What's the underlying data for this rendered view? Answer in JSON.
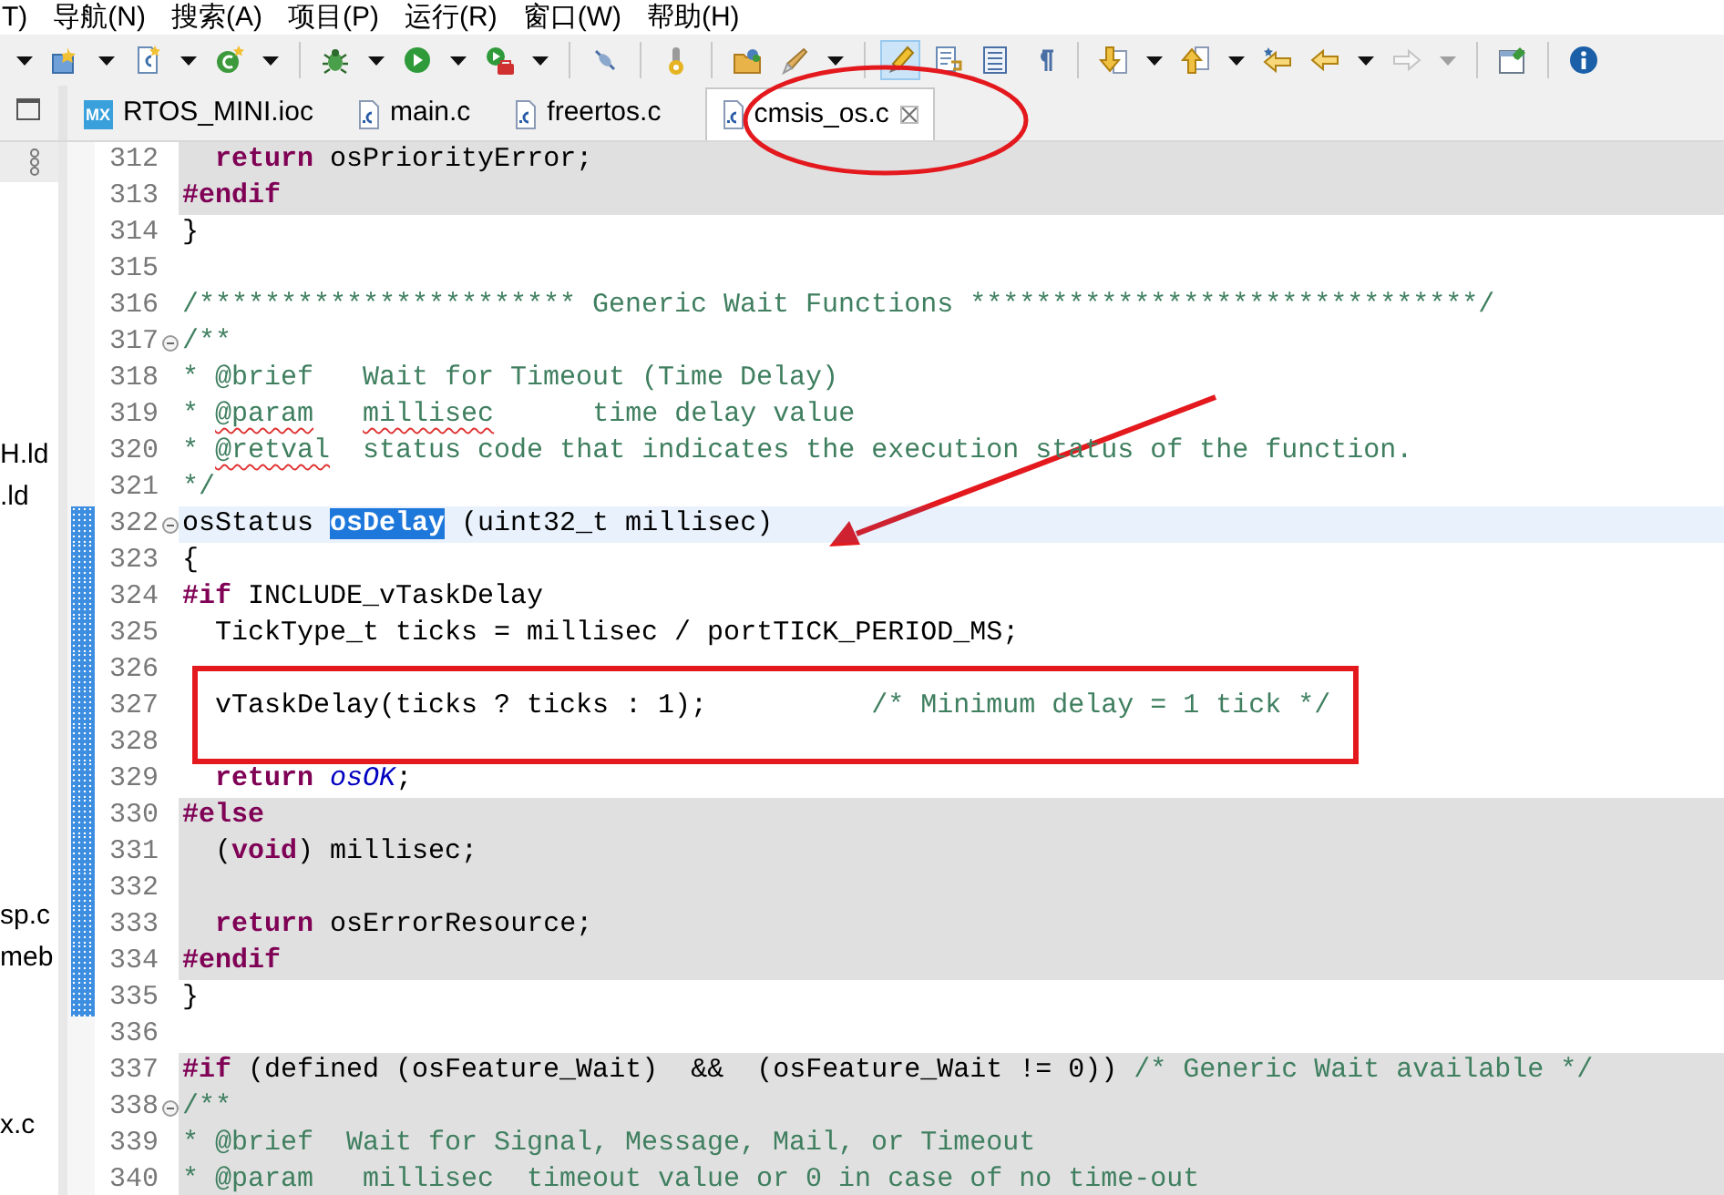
{
  "menu": [
    "T)",
    "导航(N)",
    "搜索(A)",
    "项目(P)",
    "运行(R)",
    "窗口(W)",
    "帮助(H)"
  ],
  "toolbar": [
    {
      "kind": "dropdown",
      "disabled": false
    },
    {
      "kind": "new-project",
      "disabled": false,
      "pressed": false
    },
    {
      "kind": "dropdown",
      "disabled": false
    },
    {
      "kind": "new-file",
      "disabled": false,
      "pressed": false
    },
    {
      "kind": "dropdown",
      "disabled": false
    },
    {
      "kind": "new-class",
      "disabled": false,
      "pressed": false
    },
    {
      "kind": "dropdown",
      "disabled": false
    },
    {
      "kind": "separator"
    },
    {
      "kind": "bug",
      "disabled": false,
      "pressed": false
    },
    {
      "kind": "dropdown",
      "disabled": false
    },
    {
      "kind": "run",
      "disabled": false,
      "pressed": false
    },
    {
      "kind": "dropdown",
      "disabled": false
    },
    {
      "kind": "run-tool",
      "disabled": false,
      "pressed": false
    },
    {
      "kind": "dropdown",
      "disabled": false
    },
    {
      "kind": "separator"
    },
    {
      "kind": "pin",
      "disabled": false,
      "pressed": false
    },
    {
      "kind": "separator"
    },
    {
      "kind": "gauge",
      "disabled": false,
      "pressed": false
    },
    {
      "kind": "separator"
    },
    {
      "kind": "folder",
      "disabled": false,
      "pressed": false
    },
    {
      "kind": "brush",
      "disabled": false,
      "pressed": false
    },
    {
      "kind": "dropdown",
      "disabled": false
    },
    {
      "kind": "separator"
    },
    {
      "kind": "marker",
      "disabled": false,
      "pressed": true
    },
    {
      "kind": "doc-edit",
      "disabled": false,
      "pressed": false
    },
    {
      "kind": "doc-list",
      "disabled": false,
      "pressed": false
    },
    {
      "kind": "paragraph",
      "disabled": false,
      "pressed": false
    },
    {
      "kind": "separator"
    },
    {
      "kind": "next",
      "disabled": false,
      "pressed": false
    },
    {
      "kind": "dropdown",
      "disabled": false
    },
    {
      "kind": "prev",
      "disabled": false,
      "pressed": false
    },
    {
      "kind": "dropdown",
      "disabled": false
    },
    {
      "kind": "last-edit",
      "disabled": false,
      "pressed": false
    },
    {
      "kind": "back",
      "disabled": false,
      "pressed": false
    },
    {
      "kind": "dropdown",
      "disabled": false
    },
    {
      "kind": "forward",
      "disabled": true,
      "pressed": false
    },
    {
      "kind": "dropdown",
      "disabled": true
    },
    {
      "kind": "separator"
    },
    {
      "kind": "window",
      "disabled": false,
      "pressed": false
    },
    {
      "kind": "separator"
    },
    {
      "kind": "info",
      "disabled": false,
      "pressed": false
    }
  ],
  "tabs": [
    {
      "label": "RTOS_MINI.ioc",
      "kind": "mx",
      "badge": "MX",
      "selected": false
    },
    {
      "label": "main.c",
      "kind": "c",
      "selected": false
    },
    {
      "label": "freertos.c",
      "kind": "c",
      "selected": false
    },
    {
      "label": "cmsis_os.c",
      "kind": "c",
      "selected": true
    }
  ],
  "project_tree": [
    [
      "H.ld",
      ".ld"
    ],
    [
      "sp.c",
      "meb"
    ],
    [
      "x.c"
    ]
  ],
  "lines": [
    {
      "number": "312",
      "shaded": true,
      "current": false,
      "changed": false,
      "tokens": [
        {
          "kind": "keyword",
          "text": "  return"
        },
        {
          "kind": "plain",
          "text": " osPriorityError;"
        }
      ]
    },
    {
      "number": "313",
      "shaded": true,
      "current": false,
      "changed": false,
      "tokens": [
        {
          "kind": "keyword",
          "text": "#endif"
        }
      ]
    },
    {
      "number": "314",
      "shaded": false,
      "current": false,
      "changed": false,
      "tokens": [
        {
          "kind": "plain",
          "text": "}"
        }
      ]
    },
    {
      "number": "315",
      "shaded": false,
      "current": false,
      "changed": false
    },
    {
      "number": "316",
      "shaded": false,
      "current": false,
      "changed": false,
      "tokens": [
        {
          "kind": "comment",
          "text": "/*********************** Generic Wait Functions *******************************/"
        }
      ]
    },
    {
      "number": "317",
      "shaded": false,
      "current": false,
      "changed": false,
      "fold_expanded": true,
      "tokens": [
        {
          "kind": "comment",
          "text": "/**"
        }
      ]
    },
    {
      "number": "318",
      "shaded": false,
      "current": false,
      "changed": false,
      "tokens": [
        {
          "kind": "comment",
          "text": "* @brief   Wait for Timeout (Time Delay)"
        }
      ]
    },
    {
      "number": "319",
      "shaded": false,
      "current": false,
      "changed": false,
      "tokens": [
        {
          "kind": "comment",
          "text": "* "
        },
        {
          "kind": "misspelled",
          "text": "@param"
        },
        {
          "kind": "misspelled",
          "text": "   millisec"
        },
        {
          "kind": "comment",
          "text": "      time delay value"
        }
      ]
    },
    {
      "number": "320",
      "shaded": false,
      "current": false,
      "changed": false,
      "tokens": [
        {
          "kind": "comment",
          "text": "* "
        },
        {
          "kind": "misspelled",
          "text": "@retval"
        },
        {
          "kind": "comment",
          "text": "  status code that indicates the execution status of the function."
        }
      ]
    },
    {
      "number": "321",
      "shaded": false,
      "current": false,
      "changed": false,
      "tokens": [
        {
          "kind": "comment",
          "text": "*/"
        }
      ]
    },
    {
      "number": "322",
      "shaded": false,
      "current": true,
      "changed": true,
      "fold_expanded": true,
      "tokens": [
        {
          "kind": "plain",
          "text": "osStatus "
        },
        {
          "kind": "selection",
          "text": "osDelay"
        },
        {
          "kind": "plain",
          "text": " (uint32_t millisec)"
        }
      ]
    },
    {
      "number": "323",
      "shaded": false,
      "current": false,
      "changed": true,
      "tokens": [
        {
          "kind": "plain",
          "text": "{"
        }
      ]
    },
    {
      "number": "324",
      "shaded": false,
      "current": false,
      "changed": true,
      "tokens": [
        {
          "kind": "keyword",
          "text": "#if"
        },
        {
          "kind": "plain",
          "text": " INCLUDE_vTaskDelay"
        }
      ]
    },
    {
      "number": "325",
      "shaded": false,
      "current": false,
      "changed": true,
      "tokens": [
        {
          "kind": "plain",
          "text": "  TickType_t ticks = millisec / portTICK_PERIOD_MS;"
        }
      ]
    },
    {
      "number": "326",
      "shaded": false,
      "current": false,
      "changed": true
    },
    {
      "number": "327",
      "shaded": false,
      "current": false,
      "changed": true,
      "tokens": [
        {
          "kind": "plain",
          "text": "  vTaskDelay(ticks ? ticks : 1);"
        },
        {
          "kind": "comment",
          "text": "          /* Minimum delay = 1 tick */"
        }
      ]
    },
    {
      "number": "328",
      "shaded": false,
      "current": false,
      "changed": true
    },
    {
      "number": "329",
      "shaded": false,
      "current": false,
      "changed": true,
      "tokens": [
        {
          "kind": "keyword",
          "text": "  return"
        },
        {
          "kind": "constant",
          "text": " osOK"
        },
        {
          "kind": "plain",
          "text": ";"
        }
      ]
    },
    {
      "number": "330",
      "shaded": true,
      "current": false,
      "changed": true,
      "tokens": [
        {
          "kind": "keyword",
          "text": "#else"
        }
      ]
    },
    {
      "number": "331",
      "shaded": true,
      "current": false,
      "changed": true,
      "tokens": [
        {
          "kind": "plain",
          "text": "  ("
        },
        {
          "kind": "keyword",
          "text": "void"
        },
        {
          "kind": "plain",
          "text": ") millisec;"
        }
      ]
    },
    {
      "number": "332",
      "shaded": true,
      "current": false,
      "changed": true
    },
    {
      "number": "333",
      "shaded": true,
      "current": false,
      "changed": true,
      "tokens": [
        {
          "kind": "keyword",
          "text": "  return"
        },
        {
          "kind": "plain",
          "text": " osErrorResource;"
        }
      ]
    },
    {
      "number": "334",
      "shaded": true,
      "current": false,
      "changed": true,
      "tokens": [
        {
          "kind": "keyword",
          "text": "#endif"
        }
      ]
    },
    {
      "number": "335",
      "shaded": false,
      "current": false,
      "changed": true,
      "tokens": [
        {
          "kind": "plain",
          "text": "}"
        }
      ]
    },
    {
      "number": "336",
      "shaded": false,
      "current": false,
      "changed": false
    },
    {
      "number": "337",
      "shaded": true,
      "current": false,
      "changed": false,
      "tokens": [
        {
          "kind": "keyword",
          "text": "#if"
        },
        {
          "kind": "plain",
          "text": " (defined (osFeature_Wait)  &&  (osFeature_Wait != 0))"
        },
        {
          "kind": "comment",
          "text": " /* Generic Wait available */"
        }
      ]
    },
    {
      "number": "338",
      "shaded": true,
      "current": false,
      "changed": false,
      "fold_expanded": true,
      "tokens": [
        {
          "kind": "comment",
          "text": "/**"
        }
      ]
    },
    {
      "number": "339",
      "shaded": true,
      "current": false,
      "changed": false,
      "tokens": [
        {
          "kind": "comment",
          "text": "* @brief  Wait for Signal, Message, Mail, or Timeout"
        }
      ]
    },
    {
      "number": "340",
      "shaded": true,
      "current": false,
      "changed": false,
      "tokens": [
        {
          "kind": "comment",
          "text": "* @param   millisec  timeout value or 0 in case of no time-out"
        }
      ]
    }
  ],
  "annotations": [
    {
      "kind": "ellipse"
    },
    {
      "kind": "arrow"
    },
    {
      "kind": "rectangle"
    }
  ]
}
